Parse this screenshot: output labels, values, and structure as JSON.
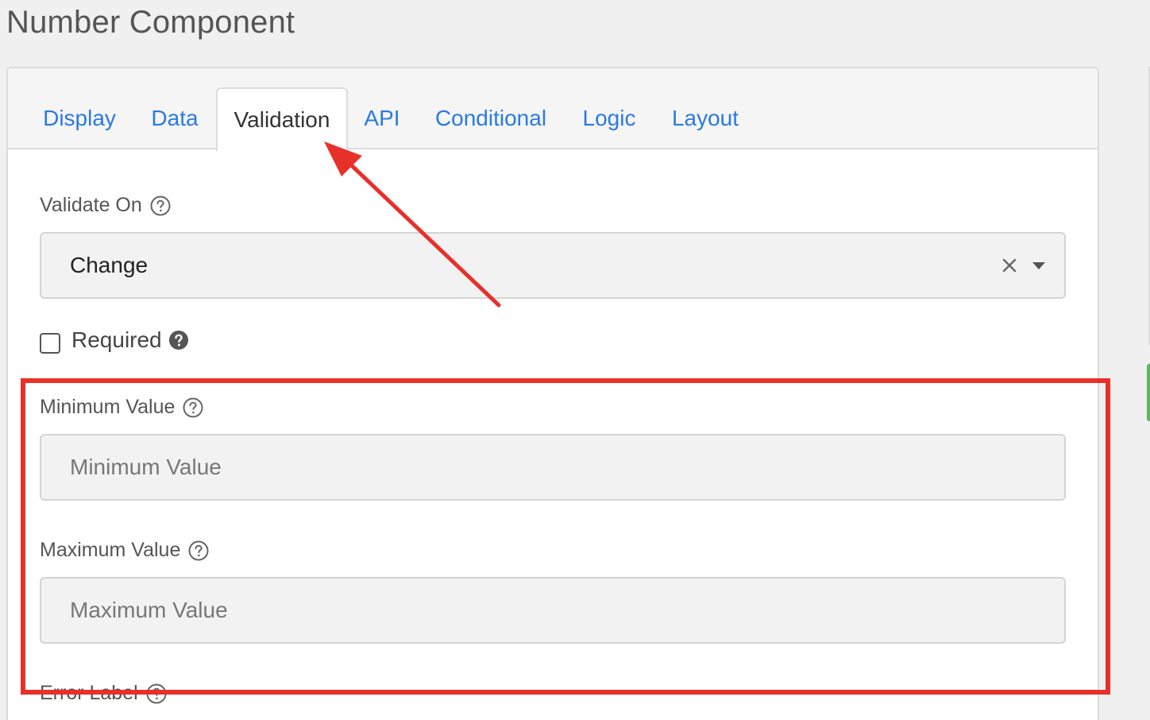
{
  "page": {
    "title": "Number Component"
  },
  "tabs": [
    {
      "label": "Display",
      "active": false
    },
    {
      "label": "Data",
      "active": false
    },
    {
      "label": "Validation",
      "active": true
    },
    {
      "label": "API",
      "active": false
    },
    {
      "label": "Conditional",
      "active": false
    },
    {
      "label": "Logic",
      "active": false
    },
    {
      "label": "Layout",
      "active": false
    }
  ],
  "form": {
    "validate_on": {
      "label": "Validate On",
      "value": "Change"
    },
    "required": {
      "label": "Required",
      "checked": false
    },
    "minimum_value": {
      "label": "Minimum Value",
      "placeholder": "Minimum Value"
    },
    "maximum_value": {
      "label": "Maximum Value",
      "placeholder": "Maximum Value"
    },
    "error_label": {
      "label": "Error Label"
    }
  },
  "colors": {
    "link": "#2a7ae2",
    "annotation": "#e8302a",
    "accent_green": "#5cb85c"
  }
}
